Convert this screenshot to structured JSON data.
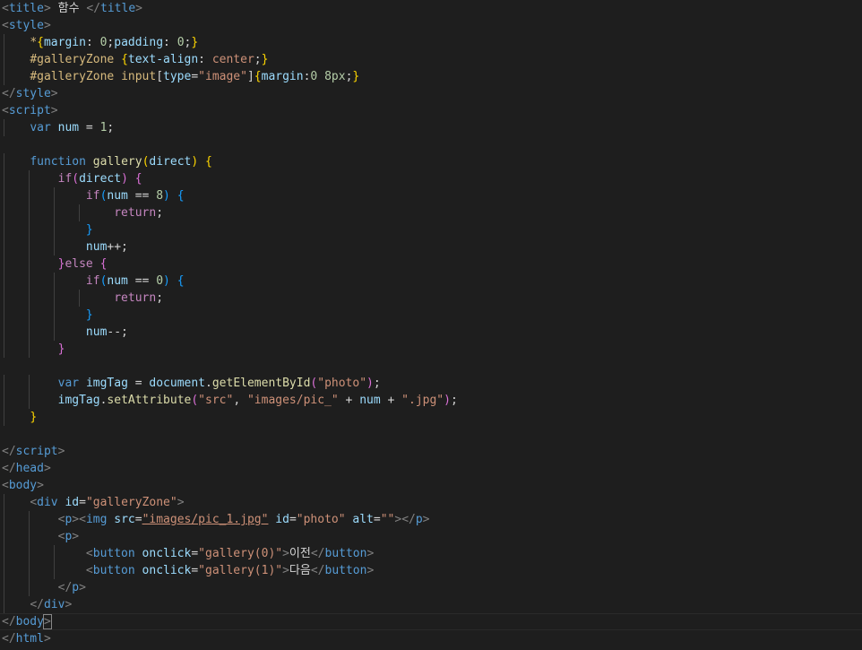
{
  "editor": {
    "lines": [
      [
        [
          "tag",
          "<"
        ],
        [
          "tagname",
          "title"
        ],
        [
          "tag",
          ">"
        ],
        [
          "text",
          " 함수 "
        ],
        [
          "tag",
          "</"
        ],
        [
          "tagname",
          "title"
        ],
        [
          "tag",
          ">"
        ]
      ],
      [
        [
          "tag",
          "<"
        ],
        [
          "tagname",
          "style"
        ],
        [
          "tag",
          ">"
        ]
      ],
      [
        [
          "text",
          "    "
        ],
        [
          "sel",
          "*"
        ],
        [
          "brace-yellow",
          "{"
        ],
        [
          "prop",
          "margin"
        ],
        [
          "punc",
          ": "
        ],
        [
          "num",
          "0"
        ],
        [
          "punc",
          ";"
        ],
        [
          "prop",
          "padding"
        ],
        [
          "punc",
          ": "
        ],
        [
          "num",
          "0"
        ],
        [
          "punc",
          ";"
        ],
        [
          "brace-yellow",
          "}"
        ]
      ],
      [
        [
          "text",
          "    "
        ],
        [
          "sel",
          "#galleryZone"
        ],
        [
          "punc",
          " "
        ],
        [
          "brace-yellow",
          "{"
        ],
        [
          "prop",
          "text-align"
        ],
        [
          "punc",
          ": "
        ],
        [
          "val",
          "center"
        ],
        [
          "punc",
          ";"
        ],
        [
          "brace-yellow",
          "}"
        ]
      ],
      [
        [
          "text",
          "    "
        ],
        [
          "sel",
          "#galleryZone"
        ],
        [
          "punc",
          " "
        ],
        [
          "sel",
          "input"
        ],
        [
          "punc",
          "["
        ],
        [
          "attr",
          "type"
        ],
        [
          "punc",
          "="
        ],
        [
          "str",
          "\"image\""
        ],
        [
          "punc",
          "]"
        ],
        [
          "brace-yellow",
          "{"
        ],
        [
          "prop",
          "margin"
        ],
        [
          "punc",
          ":"
        ],
        [
          "num",
          "0 8px"
        ],
        [
          "punc",
          ";"
        ],
        [
          "brace-yellow",
          "}"
        ]
      ],
      [
        [
          "tag",
          "</"
        ],
        [
          "tagname",
          "style"
        ],
        [
          "tag",
          ">"
        ]
      ],
      [
        [
          "tag",
          "<"
        ],
        [
          "tagname",
          "script"
        ],
        [
          "tag",
          ">"
        ]
      ],
      [
        [
          "text",
          "    "
        ],
        [
          "key",
          "var"
        ],
        [
          "punc",
          " "
        ],
        [
          "var",
          "num"
        ],
        [
          "punc",
          " = "
        ],
        [
          "num",
          "1"
        ],
        [
          "punc",
          ";"
        ]
      ],
      [
        [
          "text",
          ""
        ]
      ],
      [
        [
          "text",
          "    "
        ],
        [
          "key",
          "function"
        ],
        [
          "punc",
          " "
        ],
        [
          "fn",
          "gallery"
        ],
        [
          "brace-yellow",
          "("
        ],
        [
          "var",
          "direct"
        ],
        [
          "brace-yellow",
          ")"
        ],
        [
          "punc",
          " "
        ],
        [
          "brace-yellow",
          "{"
        ]
      ],
      [
        [
          "text",
          "        "
        ],
        [
          "ctrl",
          "if"
        ],
        [
          "brace-pink",
          "("
        ],
        [
          "var",
          "direct"
        ],
        [
          "brace-pink",
          ")"
        ],
        [
          "punc",
          " "
        ],
        [
          "brace-pink",
          "{"
        ]
      ],
      [
        [
          "text",
          "            "
        ],
        [
          "ctrl",
          "if"
        ],
        [
          "brace-blue",
          "("
        ],
        [
          "var",
          "num"
        ],
        [
          "punc",
          " == "
        ],
        [
          "num",
          "8"
        ],
        [
          "brace-blue",
          ")"
        ],
        [
          "punc",
          " "
        ],
        [
          "brace-blue",
          "{"
        ]
      ],
      [
        [
          "text",
          "                "
        ],
        [
          "ctrl",
          "return"
        ],
        [
          "punc",
          ";"
        ]
      ],
      [
        [
          "text",
          "            "
        ],
        [
          "brace-blue",
          "}"
        ]
      ],
      [
        [
          "text",
          "            "
        ],
        [
          "var",
          "num"
        ],
        [
          "punc",
          "++;"
        ]
      ],
      [
        [
          "text",
          "        "
        ],
        [
          "brace-pink",
          "}"
        ],
        [
          "ctrl",
          "else"
        ],
        [
          "punc",
          " "
        ],
        [
          "brace-pink",
          "{"
        ]
      ],
      [
        [
          "text",
          "            "
        ],
        [
          "ctrl",
          "if"
        ],
        [
          "brace-blue",
          "("
        ],
        [
          "var",
          "num"
        ],
        [
          "punc",
          " == "
        ],
        [
          "num",
          "0"
        ],
        [
          "brace-blue",
          ")"
        ],
        [
          "punc",
          " "
        ],
        [
          "brace-blue",
          "{"
        ]
      ],
      [
        [
          "text",
          "                "
        ],
        [
          "ctrl",
          "return"
        ],
        [
          "punc",
          ";"
        ]
      ],
      [
        [
          "text",
          "            "
        ],
        [
          "brace-blue",
          "}"
        ]
      ],
      [
        [
          "text",
          "            "
        ],
        [
          "var",
          "num"
        ],
        [
          "punc",
          "--;"
        ]
      ],
      [
        [
          "text",
          "        "
        ],
        [
          "brace-pink",
          "}"
        ]
      ],
      [
        [
          "text",
          ""
        ]
      ],
      [
        [
          "text",
          "        "
        ],
        [
          "key",
          "var"
        ],
        [
          "punc",
          " "
        ],
        [
          "var",
          "imgTag"
        ],
        [
          "punc",
          " = "
        ],
        [
          "var",
          "document"
        ],
        [
          "punc",
          "."
        ],
        [
          "fn",
          "getElementById"
        ],
        [
          "brace-pink",
          "("
        ],
        [
          "str",
          "\"photo\""
        ],
        [
          "brace-pink",
          ")"
        ],
        [
          "punc",
          ";"
        ]
      ],
      [
        [
          "text",
          "        "
        ],
        [
          "var",
          "imgTag"
        ],
        [
          "punc",
          "."
        ],
        [
          "fn",
          "setAttribute"
        ],
        [
          "brace-pink",
          "("
        ],
        [
          "str",
          "\"src\""
        ],
        [
          "punc",
          ", "
        ],
        [
          "str",
          "\"images/pic_\""
        ],
        [
          "punc",
          " + "
        ],
        [
          "var",
          "num"
        ],
        [
          "punc",
          " + "
        ],
        [
          "str",
          "\".jpg\""
        ],
        [
          "brace-pink",
          ")"
        ],
        [
          "punc",
          ";"
        ]
      ],
      [
        [
          "text",
          "    "
        ],
        [
          "brace-yellow",
          "}"
        ]
      ],
      [
        [
          "text",
          ""
        ]
      ],
      [
        [
          "tag",
          "</"
        ],
        [
          "tagname",
          "script"
        ],
        [
          "tag",
          ">"
        ]
      ],
      [
        [
          "tag",
          "</"
        ],
        [
          "tagname",
          "head"
        ],
        [
          "tag",
          ">"
        ]
      ],
      [
        [
          "tag",
          "<"
        ],
        [
          "tagname",
          "body"
        ],
        [
          "tag",
          ">"
        ]
      ],
      [
        [
          "text",
          "    "
        ],
        [
          "tag",
          "<"
        ],
        [
          "tagname",
          "div"
        ],
        [
          "punc",
          " "
        ],
        [
          "attr",
          "id"
        ],
        [
          "punc",
          "="
        ],
        [
          "str",
          "\"galleryZone\""
        ],
        [
          "tag",
          ">"
        ]
      ],
      [
        [
          "text",
          "        "
        ],
        [
          "tag",
          "<"
        ],
        [
          "tagname",
          "p"
        ],
        [
          "tag",
          ">"
        ],
        [
          "tag",
          "<"
        ],
        [
          "tagname",
          "img"
        ],
        [
          "punc",
          " "
        ],
        [
          "attr",
          "src"
        ],
        [
          "punc",
          "="
        ],
        [
          "link",
          "\"images/pic_1.jpg\""
        ],
        [
          "punc",
          " "
        ],
        [
          "attr",
          "id"
        ],
        [
          "punc",
          "="
        ],
        [
          "str",
          "\"photo\""
        ],
        [
          "punc",
          " "
        ],
        [
          "attr",
          "alt"
        ],
        [
          "punc",
          "="
        ],
        [
          "str",
          "\"\""
        ],
        [
          "tag",
          ">"
        ],
        [
          "tag",
          "</"
        ],
        [
          "tagname",
          "p"
        ],
        [
          "tag",
          ">"
        ]
      ],
      [
        [
          "text",
          "        "
        ],
        [
          "tag",
          "<"
        ],
        [
          "tagname",
          "p"
        ],
        [
          "tag",
          ">"
        ]
      ],
      [
        [
          "text",
          "            "
        ],
        [
          "tag",
          "<"
        ],
        [
          "tagname",
          "button"
        ],
        [
          "punc",
          " "
        ],
        [
          "attr",
          "onclick"
        ],
        [
          "punc",
          "="
        ],
        [
          "str",
          "\"gallery(0)\""
        ],
        [
          "tag",
          ">"
        ],
        [
          "text",
          "이전"
        ],
        [
          "tag",
          "</"
        ],
        [
          "tagname",
          "button"
        ],
        [
          "tag",
          ">"
        ]
      ],
      [
        [
          "text",
          "            "
        ],
        [
          "tag",
          "<"
        ],
        [
          "tagname",
          "button"
        ],
        [
          "punc",
          " "
        ],
        [
          "attr",
          "onclick"
        ],
        [
          "punc",
          "="
        ],
        [
          "str",
          "\"gallery(1)\""
        ],
        [
          "tag",
          ">"
        ],
        [
          "text",
          "다음"
        ],
        [
          "tag",
          "</"
        ],
        [
          "tagname",
          "button"
        ],
        [
          "tag",
          ">"
        ]
      ],
      [
        [
          "text",
          "        "
        ],
        [
          "tag",
          "</"
        ],
        [
          "tagname",
          "p"
        ],
        [
          "tag",
          ">"
        ]
      ],
      [
        [
          "text",
          "    "
        ],
        [
          "tag",
          "</"
        ],
        [
          "tagname",
          "div"
        ],
        [
          "tag",
          ">"
        ]
      ],
      [
        [
          "tag",
          "</"
        ],
        [
          "tagname",
          "body"
        ],
        [
          "tag",
          ">"
        ]
      ],
      [
        [
          "tag",
          "</"
        ],
        [
          "tagname",
          "html"
        ],
        [
          "tag",
          ">"
        ]
      ]
    ],
    "current_line": 36
  }
}
